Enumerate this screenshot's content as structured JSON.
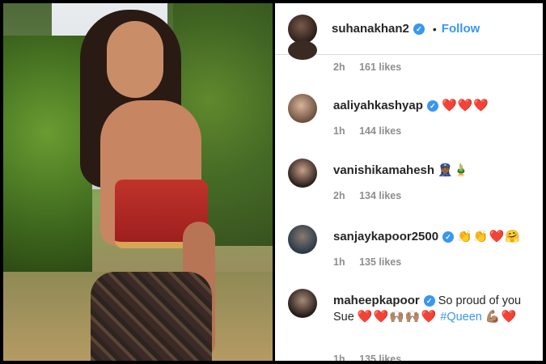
{
  "post": {
    "username": "suhanakhan2",
    "follow_label": "Follow",
    "dot": "•"
  },
  "previous_meta": {
    "time": "2h",
    "likes": "161 likes"
  },
  "comments": [
    {
      "username": "aaliyahkashyap",
      "verified": true,
      "text": "",
      "emoji": "❤️❤️❤️",
      "time": "1h",
      "likes": "144 likes"
    },
    {
      "username": "vanishikamahesh",
      "verified": false,
      "text": "",
      "emoji": "👮🏾‍♀️🎍",
      "time": "2h",
      "likes": "134 likes"
    },
    {
      "username": "sanjaykapoor2500",
      "verified": true,
      "text": "",
      "emoji": "👏👏❤️🤗",
      "time": "1h",
      "likes": "135 likes"
    },
    {
      "username": "maheepkapoor",
      "verified": true,
      "text": "So proud of you Sue",
      "emoji": "❤️❤️🙌🏽🙌🏽❤️",
      "hashtag": "#Queen",
      "emoji2": "💪🏽❤️",
      "time": "1h",
      "likes": "135 likes"
    }
  ]
}
